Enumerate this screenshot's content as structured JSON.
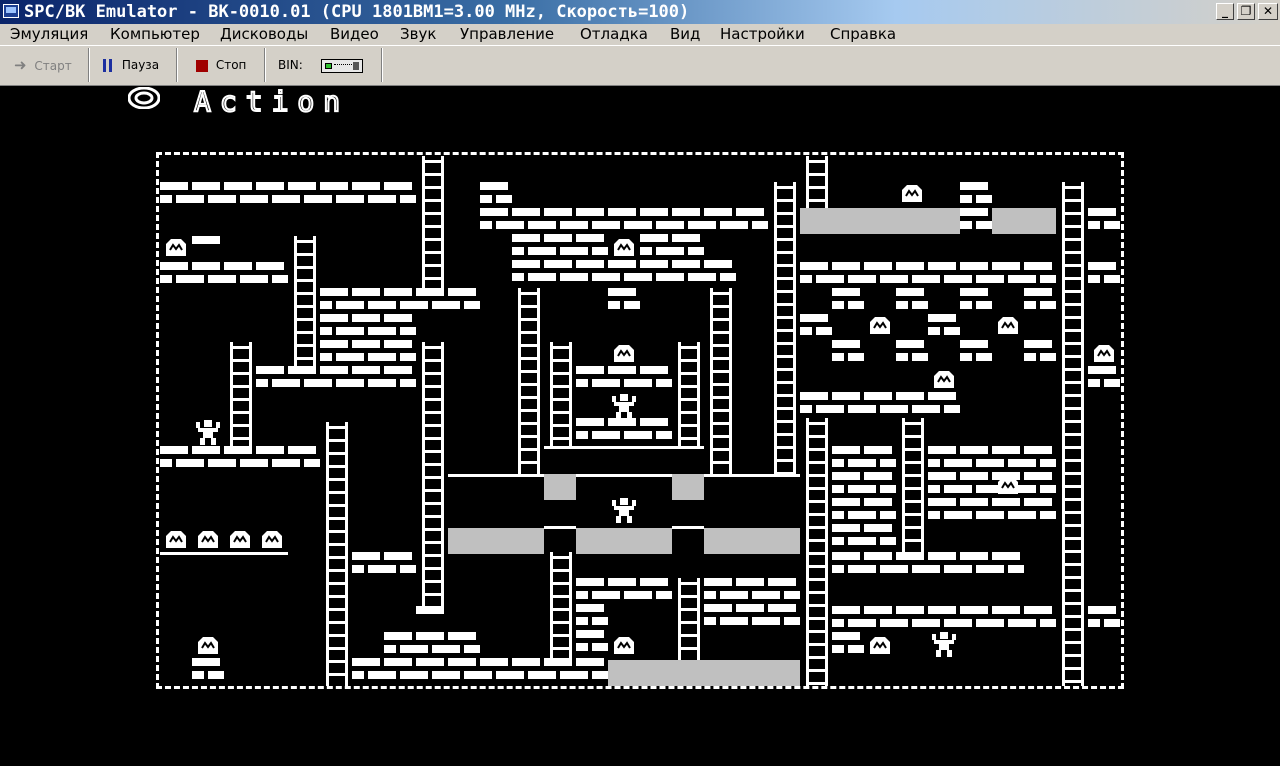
{
  "window": {
    "title": "SPC/BK Emulator - BK-0010.01 (CPU 1801BM1=3.00 MHz, Скорость=100)",
    "buttons": {
      "minimize": "_",
      "restore": "❐",
      "close": "✕"
    }
  },
  "menu": [
    "Эмуляция",
    "Компьютер",
    "Дисководы",
    "Видео",
    "Звук",
    "Управление",
    "Отладка",
    "Вид",
    "Настройки",
    "Справка"
  ],
  "toolbar": {
    "start_label": "Старт",
    "pause_label": "Пауза",
    "stop_label": "Стоп",
    "bin_label": "BIN:"
  },
  "game": {
    "title": "Action"
  },
  "colors": {
    "background": "#000000",
    "foreground": "#ffffff",
    "panel": "#c0c0c0",
    "chrome": "#d4d0c8"
  }
}
